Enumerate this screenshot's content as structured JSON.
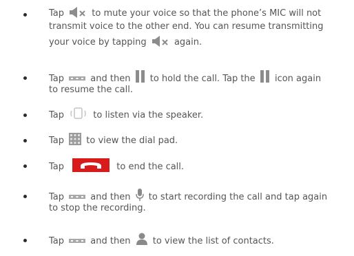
{
  "items": [
    {
      "icon": "mute-icon",
      "lines": [
        {
          "before": "Tap",
          "after": "to mute your voice so that the phone’s MIC will not"
        },
        {
          "text": "transmit voice to the other end. You can resume transmitting"
        },
        {
          "before": "your voice by tapping",
          "after": "again."
        }
      ]
    },
    {
      "icons": [
        "more-icon",
        "hold-icon"
      ],
      "lines": [
        {
          "tap": "Tap",
          "and_then": "and then",
          "hold_text": "to hold the call. Tap the",
          "icon_again": "icon again"
        },
        {
          "text": "to resume the call."
        }
      ]
    },
    {
      "icon": "speaker-icon",
      "before": "Tap",
      "after": "to listen via the speaker."
    },
    {
      "icon": "dialpad-icon",
      "before": "Tap",
      "after": "to view the dial pad."
    },
    {
      "icon": "end-call-icon",
      "before": "Tap",
      "after": "to end the call."
    },
    {
      "icons": [
        "more-icon",
        "microphone-icon"
      ],
      "lines": [
        {
          "tap": "Tap",
          "and_then": "and then",
          "after": "to start recording the call and tap again"
        },
        {
          "text": "to stop the recording."
        }
      ]
    },
    {
      "icons": [
        "more-icon",
        "contacts-icon"
      ],
      "tap": "Tap",
      "and_then": "and then",
      "after": "to view the list of contacts."
    }
  ],
  "colors": {
    "text": "#555555",
    "bullet": "#2b2b2b",
    "icon_gray": "#8c8c8c",
    "end_call_red": "#d81b1b",
    "mic_gray": "#8a8a8a"
  }
}
